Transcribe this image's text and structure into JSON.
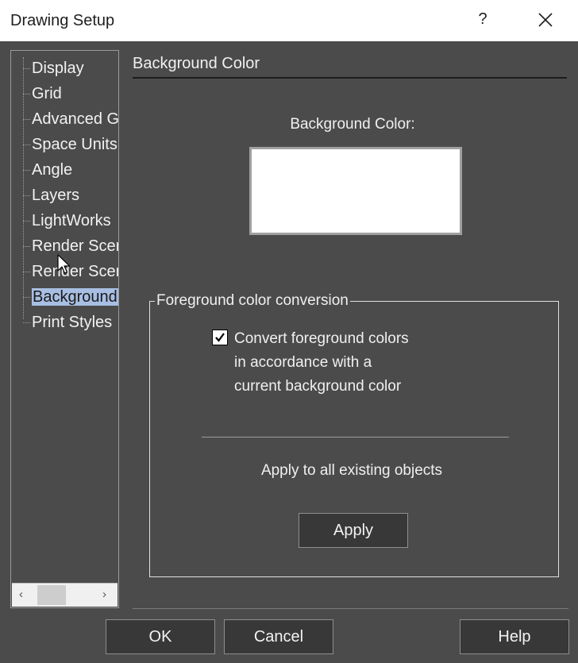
{
  "window": {
    "title": "Drawing Setup",
    "help_glyph": "?"
  },
  "tree": {
    "items": [
      {
        "label": "Display",
        "selected": false
      },
      {
        "label": "Grid",
        "selected": false
      },
      {
        "label": "Advanced G",
        "selected": false
      },
      {
        "label": "Space Units",
        "selected": false
      },
      {
        "label": "Angle",
        "selected": false
      },
      {
        "label": "Layers",
        "selected": false
      },
      {
        "label": "LightWorks",
        "selected": false
      },
      {
        "label": "Render Scer",
        "selected": false
      },
      {
        "label": "Render Scer",
        "selected": false
      },
      {
        "label": "Background",
        "selected": true
      },
      {
        "label": "Print Styles",
        "selected": false
      }
    ],
    "scroll_left": "‹",
    "scroll_right": "›"
  },
  "panel": {
    "header": "Background Color",
    "bg_color_label": "Background Color:",
    "bg_color_value": "#ffffff",
    "group_title": "Foreground color conversion",
    "checkbox_checked": true,
    "checkbox_lines": [
      "Convert foreground colors",
      "in accordance with a",
      "current background color"
    ],
    "apply_all_label": "Apply to all existing objects",
    "apply_button": "Apply"
  },
  "footer": {
    "ok": "OK",
    "cancel": "Cancel",
    "help": "Help"
  },
  "colors": {
    "dialog_bg": "#4b4b4b",
    "selection": "#a8bfe3",
    "button_bg": "#383838"
  },
  "icons": {
    "close": "close-icon",
    "checkmark": "checkmark-icon",
    "cursor": "mouse-cursor-icon"
  }
}
